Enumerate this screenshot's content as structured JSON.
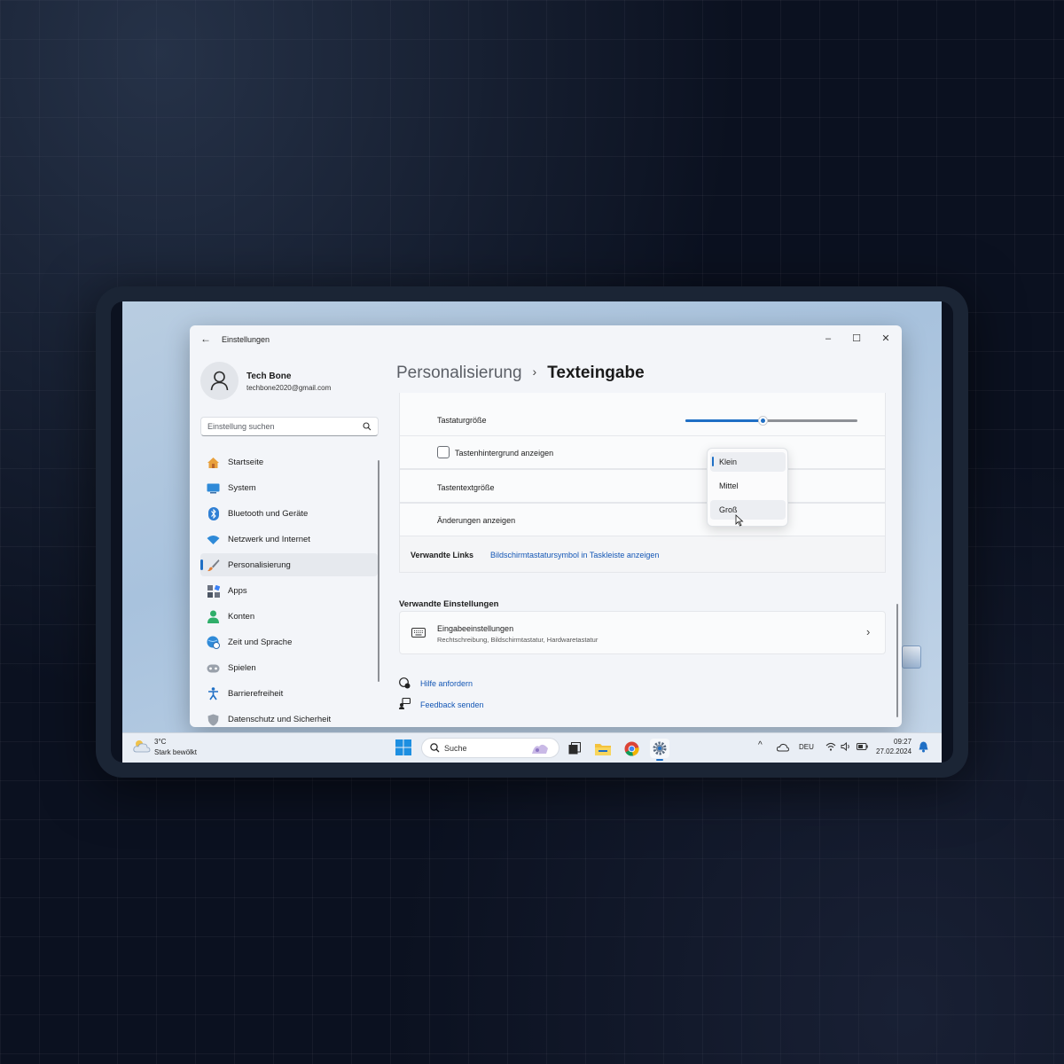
{
  "window": {
    "title": "Einstellungen",
    "back_glyph": "←",
    "controls": {
      "minimize": "–",
      "maximize": "☐",
      "close": "✕"
    }
  },
  "profile": {
    "name": "Tech Bone",
    "email": "techbone2020@gmail.com"
  },
  "search": {
    "placeholder": "Einstellung suchen"
  },
  "sidebar": {
    "items": [
      {
        "label": "Startseite",
        "icon": "home-icon"
      },
      {
        "label": "System",
        "icon": "display-icon"
      },
      {
        "label": "Bluetooth und Geräte",
        "icon": "bluetooth-icon"
      },
      {
        "label": "Netzwerk und Internet",
        "icon": "wifi-icon"
      },
      {
        "label": "Personalisierung",
        "icon": "paintbrush-icon",
        "active": true
      },
      {
        "label": "Apps",
        "icon": "apps-icon"
      },
      {
        "label": "Konten",
        "icon": "person-icon"
      },
      {
        "label": "Zeit und Sprache",
        "icon": "globe-clock-icon"
      },
      {
        "label": "Spielen",
        "icon": "gamepad-icon"
      },
      {
        "label": "Barrierefreiheit",
        "icon": "accessibility-icon"
      },
      {
        "label": "Datenschutz und Sicherheit",
        "icon": "shield-icon"
      }
    ]
  },
  "breadcrumb": {
    "parent": "Personalisierung",
    "separator": "›",
    "current": "Texteingabe"
  },
  "settings": {
    "keyboard_size": {
      "label": "Tastaturgröße",
      "value_fraction": 0.45
    },
    "key_background": {
      "label": "Tastenhintergrund anzeigen",
      "checked": false
    },
    "key_text_size": {
      "label": "Tastentextgröße",
      "options": [
        "Klein",
        "Mittel",
        "Groß"
      ],
      "selected": "Klein",
      "hovered": "Groß"
    },
    "show_changes": {
      "label": "Änderungen anzeigen"
    },
    "related_links": {
      "label": "Verwandte Links",
      "link": "Bildschirmtastatursymbol in Taskleiste anzeigen"
    }
  },
  "related_settings": {
    "heading": "Verwandte Einstellungen",
    "input_settings": {
      "title": "Eingabeeinstellungen",
      "subtitle": "Rechtschreibung, Bildschirmtastatur, Hardwaretastatur",
      "chevron": "›"
    }
  },
  "help": {
    "get_help": "Hilfe anfordern",
    "feedback": "Feedback senden"
  },
  "taskbar": {
    "weather": {
      "temp": "3°C",
      "desc": "Stark bewölkt"
    },
    "search_label": "Suche",
    "language": "DEU",
    "time": "09:27",
    "date": "27.02.2024",
    "overflow_glyph": "^"
  },
  "colors": {
    "accent": "#1f6fc5",
    "link": "#1457b5"
  }
}
